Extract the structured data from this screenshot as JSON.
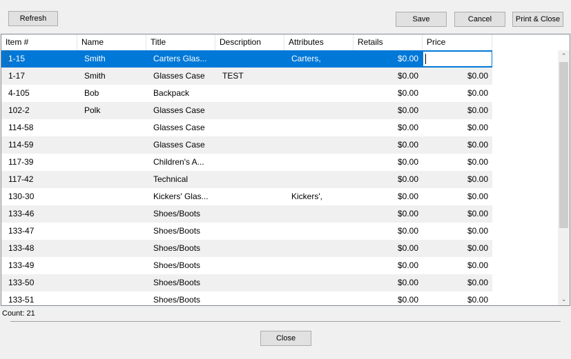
{
  "toolbar": {
    "refresh_label": "Refresh",
    "save_label": "Save",
    "cancel_label": "Cancel",
    "print_close_label": "Print & Close"
  },
  "grid": {
    "columns": [
      "Item #",
      "Name",
      "Title",
      "Description",
      "Attributes",
      "Retails",
      "Price"
    ],
    "rows": [
      [
        "1-15",
        "Smith",
        "Carters Glas...",
        "",
        "Carters,",
        "$0.00",
        ""
      ],
      [
        "1-17",
        "Smith",
        "Glasses Case",
        "TEST",
        "",
        "$0.00",
        "$0.00"
      ],
      [
        "4-105",
        "Bob",
        "Backpack",
        "",
        "",
        "$0.00",
        "$0.00"
      ],
      [
        "102-2",
        "Polk",
        "Glasses Case",
        "",
        "",
        "$0.00",
        "$0.00"
      ],
      [
        "114-58",
        "",
        "Glasses Case",
        "",
        "",
        "$0.00",
        "$0.00"
      ],
      [
        "114-59",
        "",
        "Glasses Case",
        "",
        "",
        "$0.00",
        "$0.00"
      ],
      [
        "117-39",
        "",
        "Children's A...",
        "",
        "",
        "$0.00",
        "$0.00"
      ],
      [
        "117-42",
        "",
        "Technical",
        "",
        "",
        "$0.00",
        "$0.00"
      ],
      [
        "130-30",
        "",
        "Kickers' Glas...",
        "",
        "Kickers',",
        "$0.00",
        "$0.00"
      ],
      [
        "133-46",
        "",
        "Shoes/Boots",
        "",
        "",
        "$0.00",
        "$0.00"
      ],
      [
        "133-47",
        "",
        "Shoes/Boots",
        "",
        "",
        "$0.00",
        "$0.00"
      ],
      [
        "133-48",
        "",
        "Shoes/Boots",
        "",
        "",
        "$0.00",
        "$0.00"
      ],
      [
        "133-49",
        "",
        "Shoes/Boots",
        "",
        "",
        "$0.00",
        "$0.00"
      ],
      [
        "133-50",
        "",
        "Shoes/Boots",
        "",
        "",
        "$0.00",
        "$0.00"
      ],
      [
        "133-51",
        "",
        "Shoes/Boots",
        "",
        "",
        "$0.00",
        "$0.00"
      ]
    ],
    "selected_row": 0,
    "editing_column": 6,
    "selection_color": "#0078d7",
    "alt_row_color": "#f0f0f0"
  },
  "scrollbar": {
    "up_icon": "chevron-up-icon",
    "down_icon": "chevron-down-icon",
    "up_glyph": "⌃",
    "down_glyph": "⌄"
  },
  "footer": {
    "count_text": "Count: 21",
    "close_label": "Close"
  }
}
